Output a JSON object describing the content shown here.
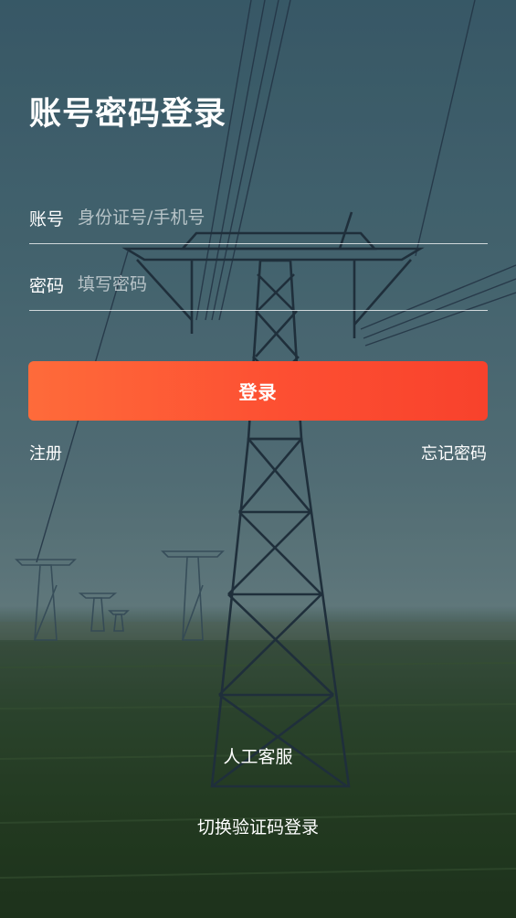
{
  "page": {
    "title": "账号密码登录"
  },
  "form": {
    "account_label": "账号",
    "account_placeholder": "身份证号/手机号",
    "account_value": "",
    "password_label": "密码",
    "password_placeholder": "填写密码",
    "password_value": ""
  },
  "actions": {
    "login_label": "登录",
    "register_label": "注册",
    "forgot_label": "忘记密码",
    "service_label": "人工客服",
    "switch_label": "切换验证码登录"
  },
  "colors": {
    "accent_start": "#fe6b3a",
    "accent_end": "#f8422c",
    "text": "#ffffff"
  }
}
